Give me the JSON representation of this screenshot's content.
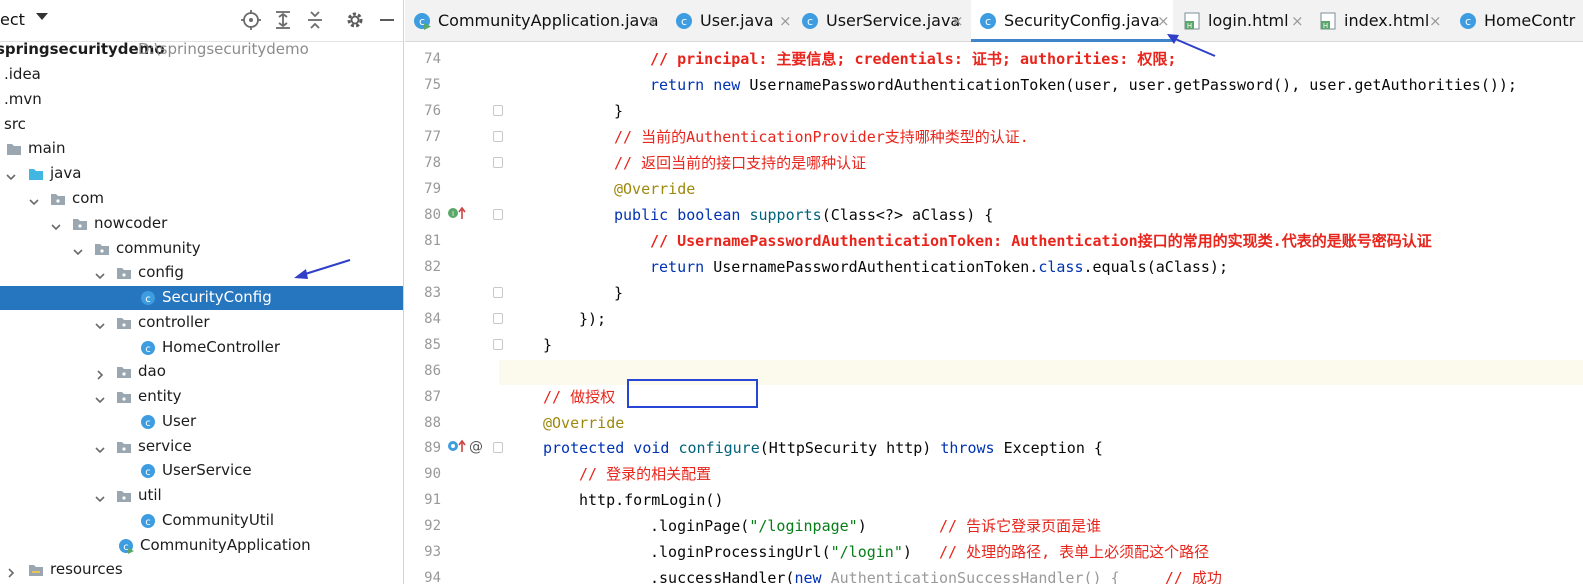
{
  "project_panel": {
    "title": "ect",
    "tree": [
      {
        "label": "springsecuritydemo",
        "path": "D:\\springsecuritydemo"
      },
      {
        "label": ".idea"
      },
      {
        "label": ".mvn"
      },
      {
        "label": "src"
      },
      {
        "label": "main"
      },
      {
        "label": "java"
      },
      {
        "label": "com"
      },
      {
        "label": "nowcoder"
      },
      {
        "label": "community"
      },
      {
        "label": "config"
      },
      {
        "label": "SecurityConfig"
      },
      {
        "label": "controller"
      },
      {
        "label": "HomeController"
      },
      {
        "label": "dao"
      },
      {
        "label": "entity"
      },
      {
        "label": "User"
      },
      {
        "label": "service"
      },
      {
        "label": "UserService"
      },
      {
        "label": "util"
      },
      {
        "label": "CommunityUtil"
      },
      {
        "label": "CommunityApplication"
      },
      {
        "label": "resources"
      }
    ]
  },
  "tabs": [
    {
      "label": "CommunityApplication.java",
      "icon": "java-class-run-icon"
    },
    {
      "label": "User.java",
      "icon": "java-class-icon"
    },
    {
      "label": "UserService.java",
      "icon": "java-class-icon"
    },
    {
      "label": "SecurityConfig.java",
      "icon": "java-class-icon",
      "active": true
    },
    {
      "label": "login.html",
      "icon": "html-file-icon"
    },
    {
      "label": "index.html",
      "icon": "html-file-icon"
    },
    {
      "label": "HomeContr",
      "icon": "java-class-icon"
    }
  ],
  "tab_close_glyph": "×",
  "editor": {
    "line_numbers": [
      "74",
      "75",
      "76",
      "77",
      "78",
      "79",
      "80",
      "81",
      "82",
      "83",
      "84",
      "85",
      "86",
      "87",
      "88",
      "89",
      "90",
      "91",
      "92",
      "93",
      "94"
    ],
    "lines": {
      "l74": "// principal: 主要信息; credentials: 证书; authorities: 权限;",
      "l75a": "return new ",
      "l75b": "UsernamePasswordAuthenticationToken(user, user.getPassword(), user.getAuthorities());",
      "l76": "}",
      "l77": "// 当前的AuthenticationProvider支持哪种类型的认证.",
      "l78": "// 返回当前的接口支持的是哪种认证",
      "l79": "@Override",
      "l80a": "public boolean ",
      "l80b": "supports",
      "l80c": "(Class<?> aClass) {",
      "l81": "// UsernamePasswordAuthenticationToken: Authentication接口的常用的实现类.代表的是账号密码认证",
      "l82a": "return ",
      "l82b": "UsernamePasswordAuthenticationToken.",
      "l82c": "class",
      "l82d": ".equals(aClass);",
      "l83": "}",
      "l84": "});",
      "l85": "}",
      "l87": "// 做授权",
      "l88": "@Override",
      "l89a": "protected void ",
      "l89b": "configure",
      "l89c": "(HttpSecurity http) ",
      "l89d": "throws ",
      "l89e": "Exception {",
      "l90": "// 登录的相关配置",
      "l91": "http.formLogin()",
      "l92a": ".loginPage(",
      "l92b": "\"/loginpage\"",
      "l92c": ")        ",
      "l92d": "// 告诉它登录页面是谁",
      "l93a": ".loginProcessingUrl(",
      "l93b": "\"/login\"",
      "l93c": ")   ",
      "l93d": "// 处理的路径, 表单上必须配这个路径",
      "l94a": ".successHandler(",
      "l94b": "new ",
      "l94c": "AuthenticationSuccessHandler() {",
      "l94d": "     // 成功"
    }
  },
  "colors": {
    "selection": "#2675bf",
    "keyword": "#0033b3",
    "comment": "#e8251c",
    "annotation": "#9e880d",
    "string": "#067d17",
    "annotation_box": "#2846d6"
  }
}
